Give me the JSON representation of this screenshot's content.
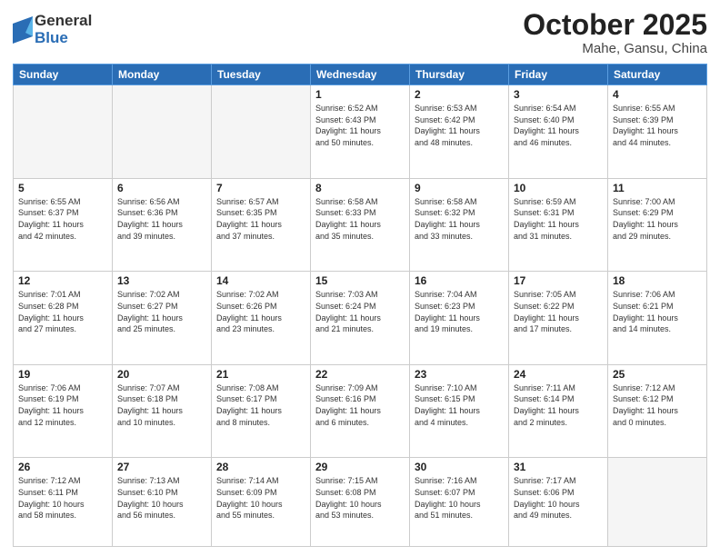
{
  "logo": {
    "general": "General",
    "blue": "Blue"
  },
  "title": "October 2025",
  "location": "Mahe, Gansu, China",
  "weekdays": [
    "Sunday",
    "Monday",
    "Tuesday",
    "Wednesday",
    "Thursday",
    "Friday",
    "Saturday"
  ],
  "weeks": [
    [
      {
        "day": "",
        "info": ""
      },
      {
        "day": "",
        "info": ""
      },
      {
        "day": "",
        "info": ""
      },
      {
        "day": "1",
        "info": "Sunrise: 6:52 AM\nSunset: 6:43 PM\nDaylight: 11 hours\nand 50 minutes."
      },
      {
        "day": "2",
        "info": "Sunrise: 6:53 AM\nSunset: 6:42 PM\nDaylight: 11 hours\nand 48 minutes."
      },
      {
        "day": "3",
        "info": "Sunrise: 6:54 AM\nSunset: 6:40 PM\nDaylight: 11 hours\nand 46 minutes."
      },
      {
        "day": "4",
        "info": "Sunrise: 6:55 AM\nSunset: 6:39 PM\nDaylight: 11 hours\nand 44 minutes."
      }
    ],
    [
      {
        "day": "5",
        "info": "Sunrise: 6:55 AM\nSunset: 6:37 PM\nDaylight: 11 hours\nand 42 minutes."
      },
      {
        "day": "6",
        "info": "Sunrise: 6:56 AM\nSunset: 6:36 PM\nDaylight: 11 hours\nand 39 minutes."
      },
      {
        "day": "7",
        "info": "Sunrise: 6:57 AM\nSunset: 6:35 PM\nDaylight: 11 hours\nand 37 minutes."
      },
      {
        "day": "8",
        "info": "Sunrise: 6:58 AM\nSunset: 6:33 PM\nDaylight: 11 hours\nand 35 minutes."
      },
      {
        "day": "9",
        "info": "Sunrise: 6:58 AM\nSunset: 6:32 PM\nDaylight: 11 hours\nand 33 minutes."
      },
      {
        "day": "10",
        "info": "Sunrise: 6:59 AM\nSunset: 6:31 PM\nDaylight: 11 hours\nand 31 minutes."
      },
      {
        "day": "11",
        "info": "Sunrise: 7:00 AM\nSunset: 6:29 PM\nDaylight: 11 hours\nand 29 minutes."
      }
    ],
    [
      {
        "day": "12",
        "info": "Sunrise: 7:01 AM\nSunset: 6:28 PM\nDaylight: 11 hours\nand 27 minutes."
      },
      {
        "day": "13",
        "info": "Sunrise: 7:02 AM\nSunset: 6:27 PM\nDaylight: 11 hours\nand 25 minutes."
      },
      {
        "day": "14",
        "info": "Sunrise: 7:02 AM\nSunset: 6:26 PM\nDaylight: 11 hours\nand 23 minutes."
      },
      {
        "day": "15",
        "info": "Sunrise: 7:03 AM\nSunset: 6:24 PM\nDaylight: 11 hours\nand 21 minutes."
      },
      {
        "day": "16",
        "info": "Sunrise: 7:04 AM\nSunset: 6:23 PM\nDaylight: 11 hours\nand 19 minutes."
      },
      {
        "day": "17",
        "info": "Sunrise: 7:05 AM\nSunset: 6:22 PM\nDaylight: 11 hours\nand 17 minutes."
      },
      {
        "day": "18",
        "info": "Sunrise: 7:06 AM\nSunset: 6:21 PM\nDaylight: 11 hours\nand 14 minutes."
      }
    ],
    [
      {
        "day": "19",
        "info": "Sunrise: 7:06 AM\nSunset: 6:19 PM\nDaylight: 11 hours\nand 12 minutes."
      },
      {
        "day": "20",
        "info": "Sunrise: 7:07 AM\nSunset: 6:18 PM\nDaylight: 11 hours\nand 10 minutes."
      },
      {
        "day": "21",
        "info": "Sunrise: 7:08 AM\nSunset: 6:17 PM\nDaylight: 11 hours\nand 8 minutes."
      },
      {
        "day": "22",
        "info": "Sunrise: 7:09 AM\nSunset: 6:16 PM\nDaylight: 11 hours\nand 6 minutes."
      },
      {
        "day": "23",
        "info": "Sunrise: 7:10 AM\nSunset: 6:15 PM\nDaylight: 11 hours\nand 4 minutes."
      },
      {
        "day": "24",
        "info": "Sunrise: 7:11 AM\nSunset: 6:14 PM\nDaylight: 11 hours\nand 2 minutes."
      },
      {
        "day": "25",
        "info": "Sunrise: 7:12 AM\nSunset: 6:12 PM\nDaylight: 11 hours\nand 0 minutes."
      }
    ],
    [
      {
        "day": "26",
        "info": "Sunrise: 7:12 AM\nSunset: 6:11 PM\nDaylight: 10 hours\nand 58 minutes."
      },
      {
        "day": "27",
        "info": "Sunrise: 7:13 AM\nSunset: 6:10 PM\nDaylight: 10 hours\nand 56 minutes."
      },
      {
        "day": "28",
        "info": "Sunrise: 7:14 AM\nSunset: 6:09 PM\nDaylight: 10 hours\nand 55 minutes."
      },
      {
        "day": "29",
        "info": "Sunrise: 7:15 AM\nSunset: 6:08 PM\nDaylight: 10 hours\nand 53 minutes."
      },
      {
        "day": "30",
        "info": "Sunrise: 7:16 AM\nSunset: 6:07 PM\nDaylight: 10 hours\nand 51 minutes."
      },
      {
        "day": "31",
        "info": "Sunrise: 7:17 AM\nSunset: 6:06 PM\nDaylight: 10 hours\nand 49 minutes."
      },
      {
        "day": "",
        "info": ""
      }
    ]
  ]
}
